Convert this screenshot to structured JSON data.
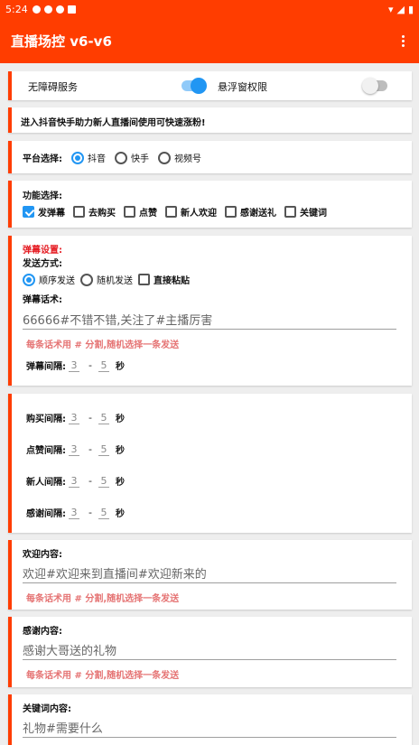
{
  "status_bar": {
    "time": "5:24"
  },
  "app_bar": {
    "title": "直播场控 v6-v6"
  },
  "services": {
    "accessibility_label": "无障碍服务",
    "overlay_label": "悬浮窗权限"
  },
  "notice": "进入抖音快手助力新人直播间使用可快速涨粉!",
  "platform": {
    "label": "平台选择:",
    "options": [
      "抖音",
      "快手",
      "视频号"
    ],
    "selected": "抖音"
  },
  "features": {
    "label": "功能选择:",
    "options": [
      {
        "label": "发弹幕",
        "checked": true
      },
      {
        "label": "去购买",
        "checked": false
      },
      {
        "label": "点赞",
        "checked": false
      },
      {
        "label": "新人欢迎",
        "checked": false
      },
      {
        "label": "感谢送礼",
        "checked": false
      },
      {
        "label": "关键词",
        "checked": false
      }
    ]
  },
  "danmu": {
    "section_title": "弹幕设置:",
    "send_mode_label": "发送方式:",
    "send_modes": [
      {
        "label": "顺序发送",
        "kind": "radio",
        "selected": true
      },
      {
        "label": "随机发送",
        "kind": "radio",
        "selected": false
      },
      {
        "label": "直接粘贴",
        "kind": "checkbox",
        "selected": false
      }
    ],
    "script_label": "弹幕话术:",
    "script_value": "66666#不错不错,关注了#主播厉害",
    "hint": "每条话术用 # 分割,随机选择一条发送",
    "interval_label": "弹幕间隔:",
    "min": "3",
    "max": "5",
    "unit": "秒"
  },
  "intervals": [
    {
      "label": "购买间隔:",
      "min": "3",
      "max": "5",
      "unit": "秒"
    },
    {
      "label": "点赞间隔:",
      "min": "3",
      "max": "5",
      "unit": "秒"
    },
    {
      "label": "新人间隔:",
      "min": "3",
      "max": "5",
      "unit": "秒"
    },
    {
      "label": "感谢间隔:",
      "min": "3",
      "max": "5",
      "unit": "秒"
    }
  ],
  "welcome": {
    "label": "欢迎内容:",
    "value": "欢迎#欢迎来到直播间#欢迎新来的",
    "hint": "每条话术用 # 分割,随机选择一条发送"
  },
  "thanks": {
    "label": "感谢内容:",
    "value": "感谢大哥送的礼物",
    "hint": "每条话术用 # 分割,随机选择一条发送"
  },
  "keyword": {
    "label": "关键词内容:",
    "value": "礼物#需要什么"
  },
  "colors": {
    "primary": "#ff3d00",
    "accent": "#2196f3",
    "hint": "#e57373"
  }
}
